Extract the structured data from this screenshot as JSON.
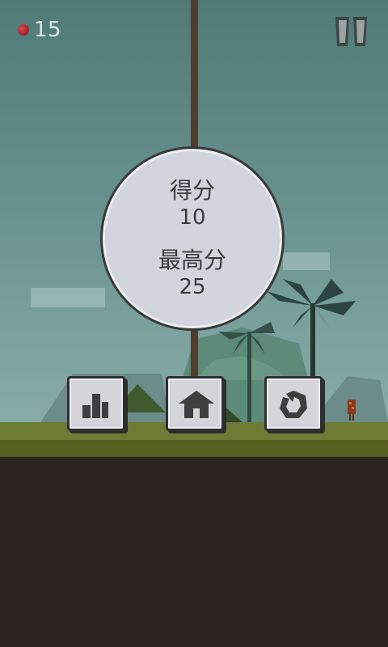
{
  "hud": {
    "seed_icon": "red-seed-icon",
    "coin_count": "15",
    "pause_icon": "pause-icon"
  },
  "scoreboard": {
    "score_label": "得分",
    "score_value": "10",
    "best_label": "最高分",
    "best_value": "25"
  },
  "buttons": [
    {
      "name": "leaderboard-button",
      "icon": "leaderboard-icon"
    },
    {
      "name": "home-button",
      "icon": "home-icon"
    },
    {
      "name": "restart-button",
      "icon": "restart-icon"
    }
  ],
  "colors": {
    "sky": "#6a9491",
    "grass": "#6e7b34",
    "dirt": "#2b2421",
    "stone": "#d2d4de",
    "rope": "#4f3d2d"
  }
}
